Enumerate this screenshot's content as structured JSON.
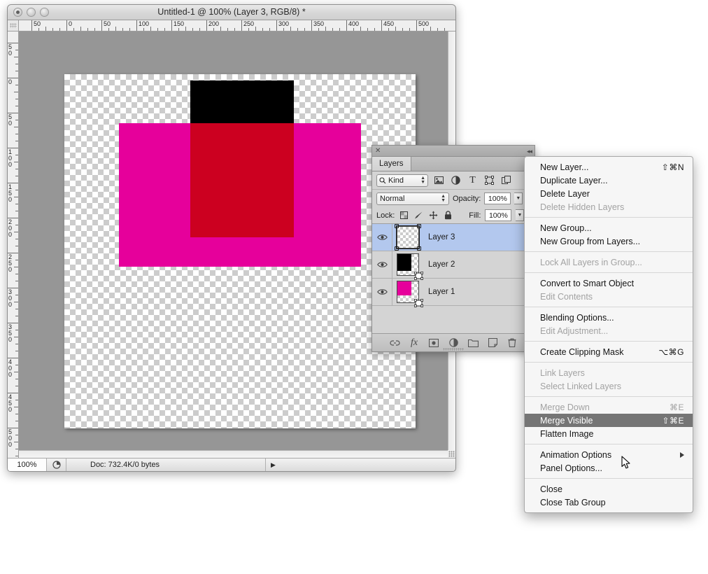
{
  "document_window": {
    "title": "Untitled-1 @ 100% (Layer 3, RGB/8) *",
    "window_controls": [
      "close",
      "minimize",
      "zoom"
    ],
    "rulers": {
      "horizontal_labels": [
        "50",
        "0",
        "50",
        "100",
        "150",
        "200",
        "250",
        "300",
        "350",
        "400",
        "450",
        "500"
      ],
      "vertical_labels": [
        "50",
        "0",
        "50",
        "100",
        "150",
        "200",
        "250",
        "300",
        "350",
        "400",
        "450",
        "500"
      ],
      "unit": "px"
    },
    "artwork": {
      "background": "transparent-checkerboard",
      "shapes": [
        {
          "name": "black-rectangle",
          "color": "#000000"
        },
        {
          "name": "magenta-rectangle",
          "color": "#E6009B"
        },
        {
          "name": "overlap-rectangle",
          "color": "#CC0020"
        }
      ]
    },
    "statusbar": {
      "zoom": "100%",
      "doc_info": "Doc: 732.4K/0 bytes",
      "arrow": "▶"
    }
  },
  "layers_panel": {
    "close_icon": "✕",
    "collapse_icon": "◂◂",
    "tab_label": "Layers",
    "filter": {
      "kind_label": "Kind",
      "search_icon": "⌕",
      "icons": [
        "pixel-layer-filter",
        "adjustment-layer-filter",
        "type-layer-filter",
        "shape-layer-filter",
        "smart-object-filter"
      ]
    },
    "blend": {
      "mode": "Normal",
      "opacity_label": "Opacity:",
      "opacity_value": "100%"
    },
    "lock": {
      "label": "Lock:",
      "icons": [
        "lock-transparent-pixels",
        "lock-image-pixels",
        "lock-position",
        "lock-all"
      ],
      "fill_label": "Fill:",
      "fill_value": "100%"
    },
    "layers": [
      {
        "name": "Layer 3",
        "visible": true,
        "selected": true,
        "thumb": "empty"
      },
      {
        "name": "Layer 2",
        "visible": true,
        "selected": false,
        "thumb": "black"
      },
      {
        "name": "Layer 1",
        "visible": true,
        "selected": false,
        "thumb": "magenta"
      }
    ],
    "bottom_icons": [
      "link-layers",
      "layer-style-fx",
      "add-layer-mask",
      "new-adjustment-layer",
      "new-group",
      "new-layer",
      "delete-layer"
    ]
  },
  "context_menu": {
    "groups": [
      [
        {
          "label": "New Layer...",
          "shortcut": "⇧⌘N",
          "disabled": false,
          "highlighted": false
        },
        {
          "label": "Duplicate Layer...",
          "shortcut": "",
          "disabled": false,
          "highlighted": false
        },
        {
          "label": "Delete Layer",
          "shortcut": "",
          "disabled": false,
          "highlighted": false
        },
        {
          "label": "Delete Hidden Layers",
          "shortcut": "",
          "disabled": true,
          "highlighted": false
        }
      ],
      [
        {
          "label": "New Group...",
          "shortcut": "",
          "disabled": false,
          "highlighted": false
        },
        {
          "label": "New Group from Layers...",
          "shortcut": "",
          "disabled": false,
          "highlighted": false
        }
      ],
      [
        {
          "label": "Lock All Layers in Group...",
          "shortcut": "",
          "disabled": true,
          "highlighted": false
        }
      ],
      [
        {
          "label": "Convert to Smart Object",
          "shortcut": "",
          "disabled": false,
          "highlighted": false
        },
        {
          "label": "Edit Contents",
          "shortcut": "",
          "disabled": true,
          "highlighted": false
        }
      ],
      [
        {
          "label": "Blending Options...",
          "shortcut": "",
          "disabled": false,
          "highlighted": false
        },
        {
          "label": "Edit Adjustment...",
          "shortcut": "",
          "disabled": true,
          "highlighted": false
        }
      ],
      [
        {
          "label": "Create Clipping Mask",
          "shortcut": "⌥⌘G",
          "disabled": false,
          "highlighted": false
        }
      ],
      [
        {
          "label": "Link Layers",
          "shortcut": "",
          "disabled": true,
          "highlighted": false
        },
        {
          "label": "Select Linked Layers",
          "shortcut": "",
          "disabled": true,
          "highlighted": false
        }
      ],
      [
        {
          "label": "Merge Down",
          "shortcut": "⌘E",
          "disabled": true,
          "highlighted": false
        },
        {
          "label": "Merge Visible",
          "shortcut": "⇧⌘E",
          "disabled": false,
          "highlighted": true
        },
        {
          "label": "Flatten Image",
          "shortcut": "",
          "disabled": false,
          "highlighted": false
        }
      ],
      [
        {
          "label": "Animation Options",
          "shortcut": "",
          "disabled": false,
          "highlighted": false,
          "submenu": true
        },
        {
          "label": "Panel Options...",
          "shortcut": "",
          "disabled": false,
          "highlighted": false
        }
      ],
      [
        {
          "label": "Close",
          "shortcut": "",
          "disabled": false,
          "highlighted": false
        },
        {
          "label": "Close Tab Group",
          "shortcut": "",
          "disabled": false,
          "highlighted": false
        }
      ]
    ]
  },
  "colors": {
    "magenta": "#E6009B",
    "black": "#000000",
    "overlap_red": "#CC0020",
    "selection_blue": "#B3C8EE",
    "menu_highlight": "#757575",
    "canvas_gray": "#969696"
  }
}
